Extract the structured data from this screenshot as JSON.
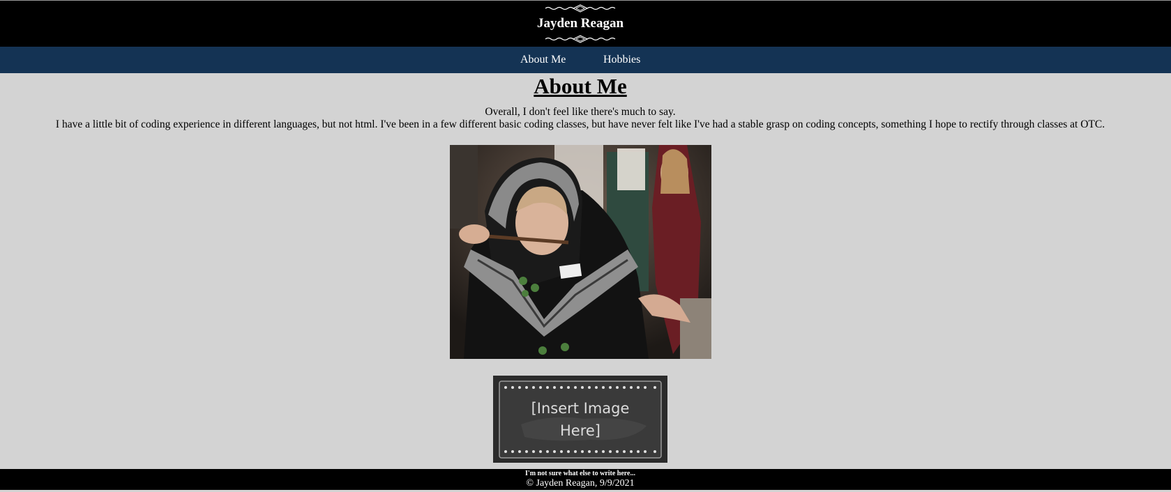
{
  "header": {
    "title": "Jayden Reagan"
  },
  "nav": {
    "items": [
      {
        "label": "About Me"
      },
      {
        "label": "Hobbies"
      }
    ]
  },
  "main": {
    "heading": "About Me",
    "paragraphs": [
      "Overall, I don't feel like there's much to say.",
      "I have a little bit of coding experience in different languages, but not html. I've been in a few different basic coding classes, but have never felt like I've had a stable grasp on coding concepts, something I hope to rectify through classes at OTC."
    ],
    "placeholder": {
      "line1": "[Insert Image",
      "line2": "Here]"
    }
  },
  "footer": {
    "note": "I'm not sure what else to write here...",
    "copyright": "© Jayden Reagan, 9/9/2021"
  },
  "colors": {
    "header_bg": "#000000",
    "nav_bg": "#143354",
    "main_bg": "#d3d3d3",
    "footer_bg": "#000000"
  }
}
